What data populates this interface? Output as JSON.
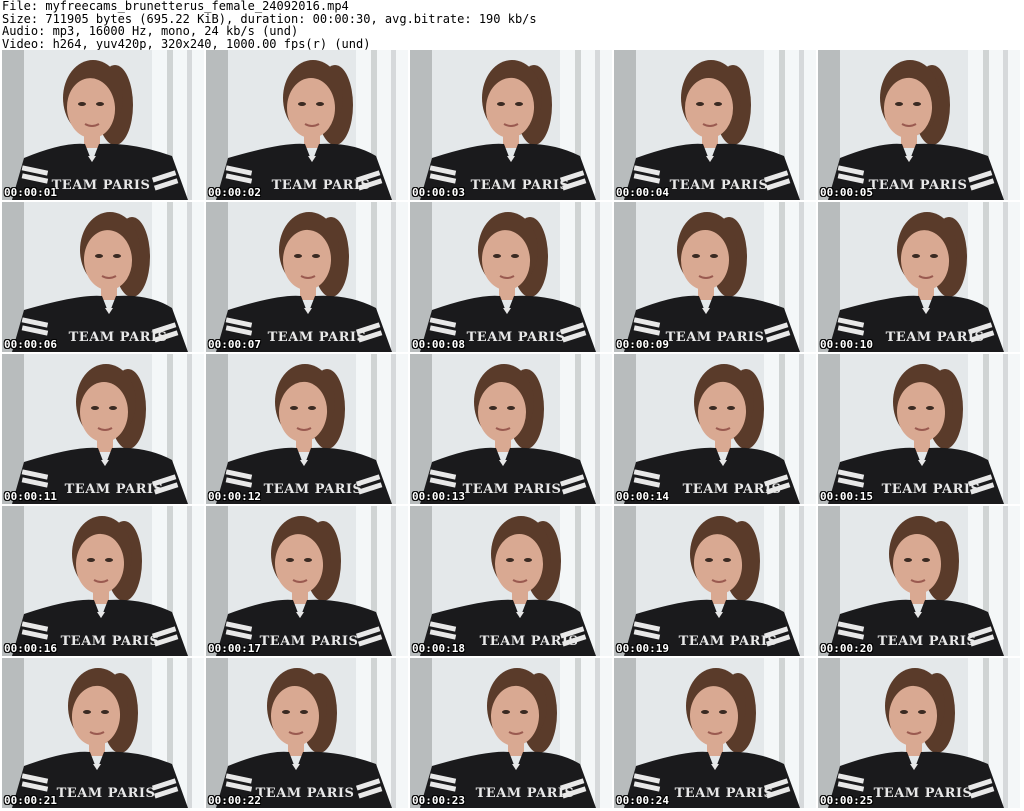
{
  "header": {
    "file_line": "File: myfreecams_brunetterus_female_24092016.mp4",
    "size_line": "Size: 711905 bytes (695.22 KiB), duration: 00:00:30, avg.bitrate: 190 kb/s",
    "audio_line": "Audio: mp3, 16000 Hz, mono, 24 kb/s (und)",
    "video_line": "Video: h264, yuv420p, 320x240, 1000.00 fps(r) (und)"
  },
  "thumbnails": [
    {
      "timestamp": "00:00:01",
      "shirt_text": "TEAM PARIS"
    },
    {
      "timestamp": "00:00:02",
      "shirt_text": "TEAM PARIS"
    },
    {
      "timestamp": "00:00:03",
      "shirt_text": "TEAM PARIS"
    },
    {
      "timestamp": "00:00:04",
      "shirt_text": "TEAM PARIS"
    },
    {
      "timestamp": "00:00:05",
      "shirt_text": "TEAM PARIS"
    },
    {
      "timestamp": "00:00:06",
      "shirt_text": "TEAM PARIS"
    },
    {
      "timestamp": "00:00:07",
      "shirt_text": "TEAM PARIS"
    },
    {
      "timestamp": "00:00:08",
      "shirt_text": "TEAM PARIS"
    },
    {
      "timestamp": "00:00:09",
      "shirt_text": "TEAM PARIS"
    },
    {
      "timestamp": "00:00:10",
      "shirt_text": "TEAM PARIS"
    },
    {
      "timestamp": "00:00:11",
      "shirt_text": "TEAM PARIS"
    },
    {
      "timestamp": "00:00:12",
      "shirt_text": "TEAM PARIS"
    },
    {
      "timestamp": "00:00:13",
      "shirt_text": "TEAM PARIS"
    },
    {
      "timestamp": "00:00:14",
      "shirt_text": "TEAM PARIS"
    },
    {
      "timestamp": "00:00:15",
      "shirt_text": "TEAM PARIS"
    },
    {
      "timestamp": "00:00:16",
      "shirt_text": "TEAM PARIS"
    },
    {
      "timestamp": "00:00:17",
      "shirt_text": "TEAM PARIS"
    },
    {
      "timestamp": "00:00:18",
      "shirt_text": "TEAM PARIS"
    },
    {
      "timestamp": "00:00:19",
      "shirt_text": "TEAM PARIS"
    },
    {
      "timestamp": "00:00:20",
      "shirt_text": "TEAM PARIS"
    },
    {
      "timestamp": "00:00:21",
      "shirt_text": "TEAM PARIS"
    },
    {
      "timestamp": "00:00:22",
      "shirt_text": "TEAM PARIS"
    },
    {
      "timestamp": "00:00:23",
      "shirt_text": "TEAM PARIS"
    },
    {
      "timestamp": "00:00:24",
      "shirt_text": "TEAM PARIS"
    },
    {
      "timestamp": "00:00:25",
      "shirt_text": "TEAM PARIS"
    }
  ],
  "colors": {
    "background": "#ffffff",
    "curtain_light": "#e4e8ea",
    "curtain_shadow": "#b8bcbd",
    "window_glow": "#f4f7f8",
    "hair": "#5a3b2a",
    "skin": "#d9a992",
    "shirt": "#1a1a1c",
    "stripe": "#e8e8e8"
  }
}
